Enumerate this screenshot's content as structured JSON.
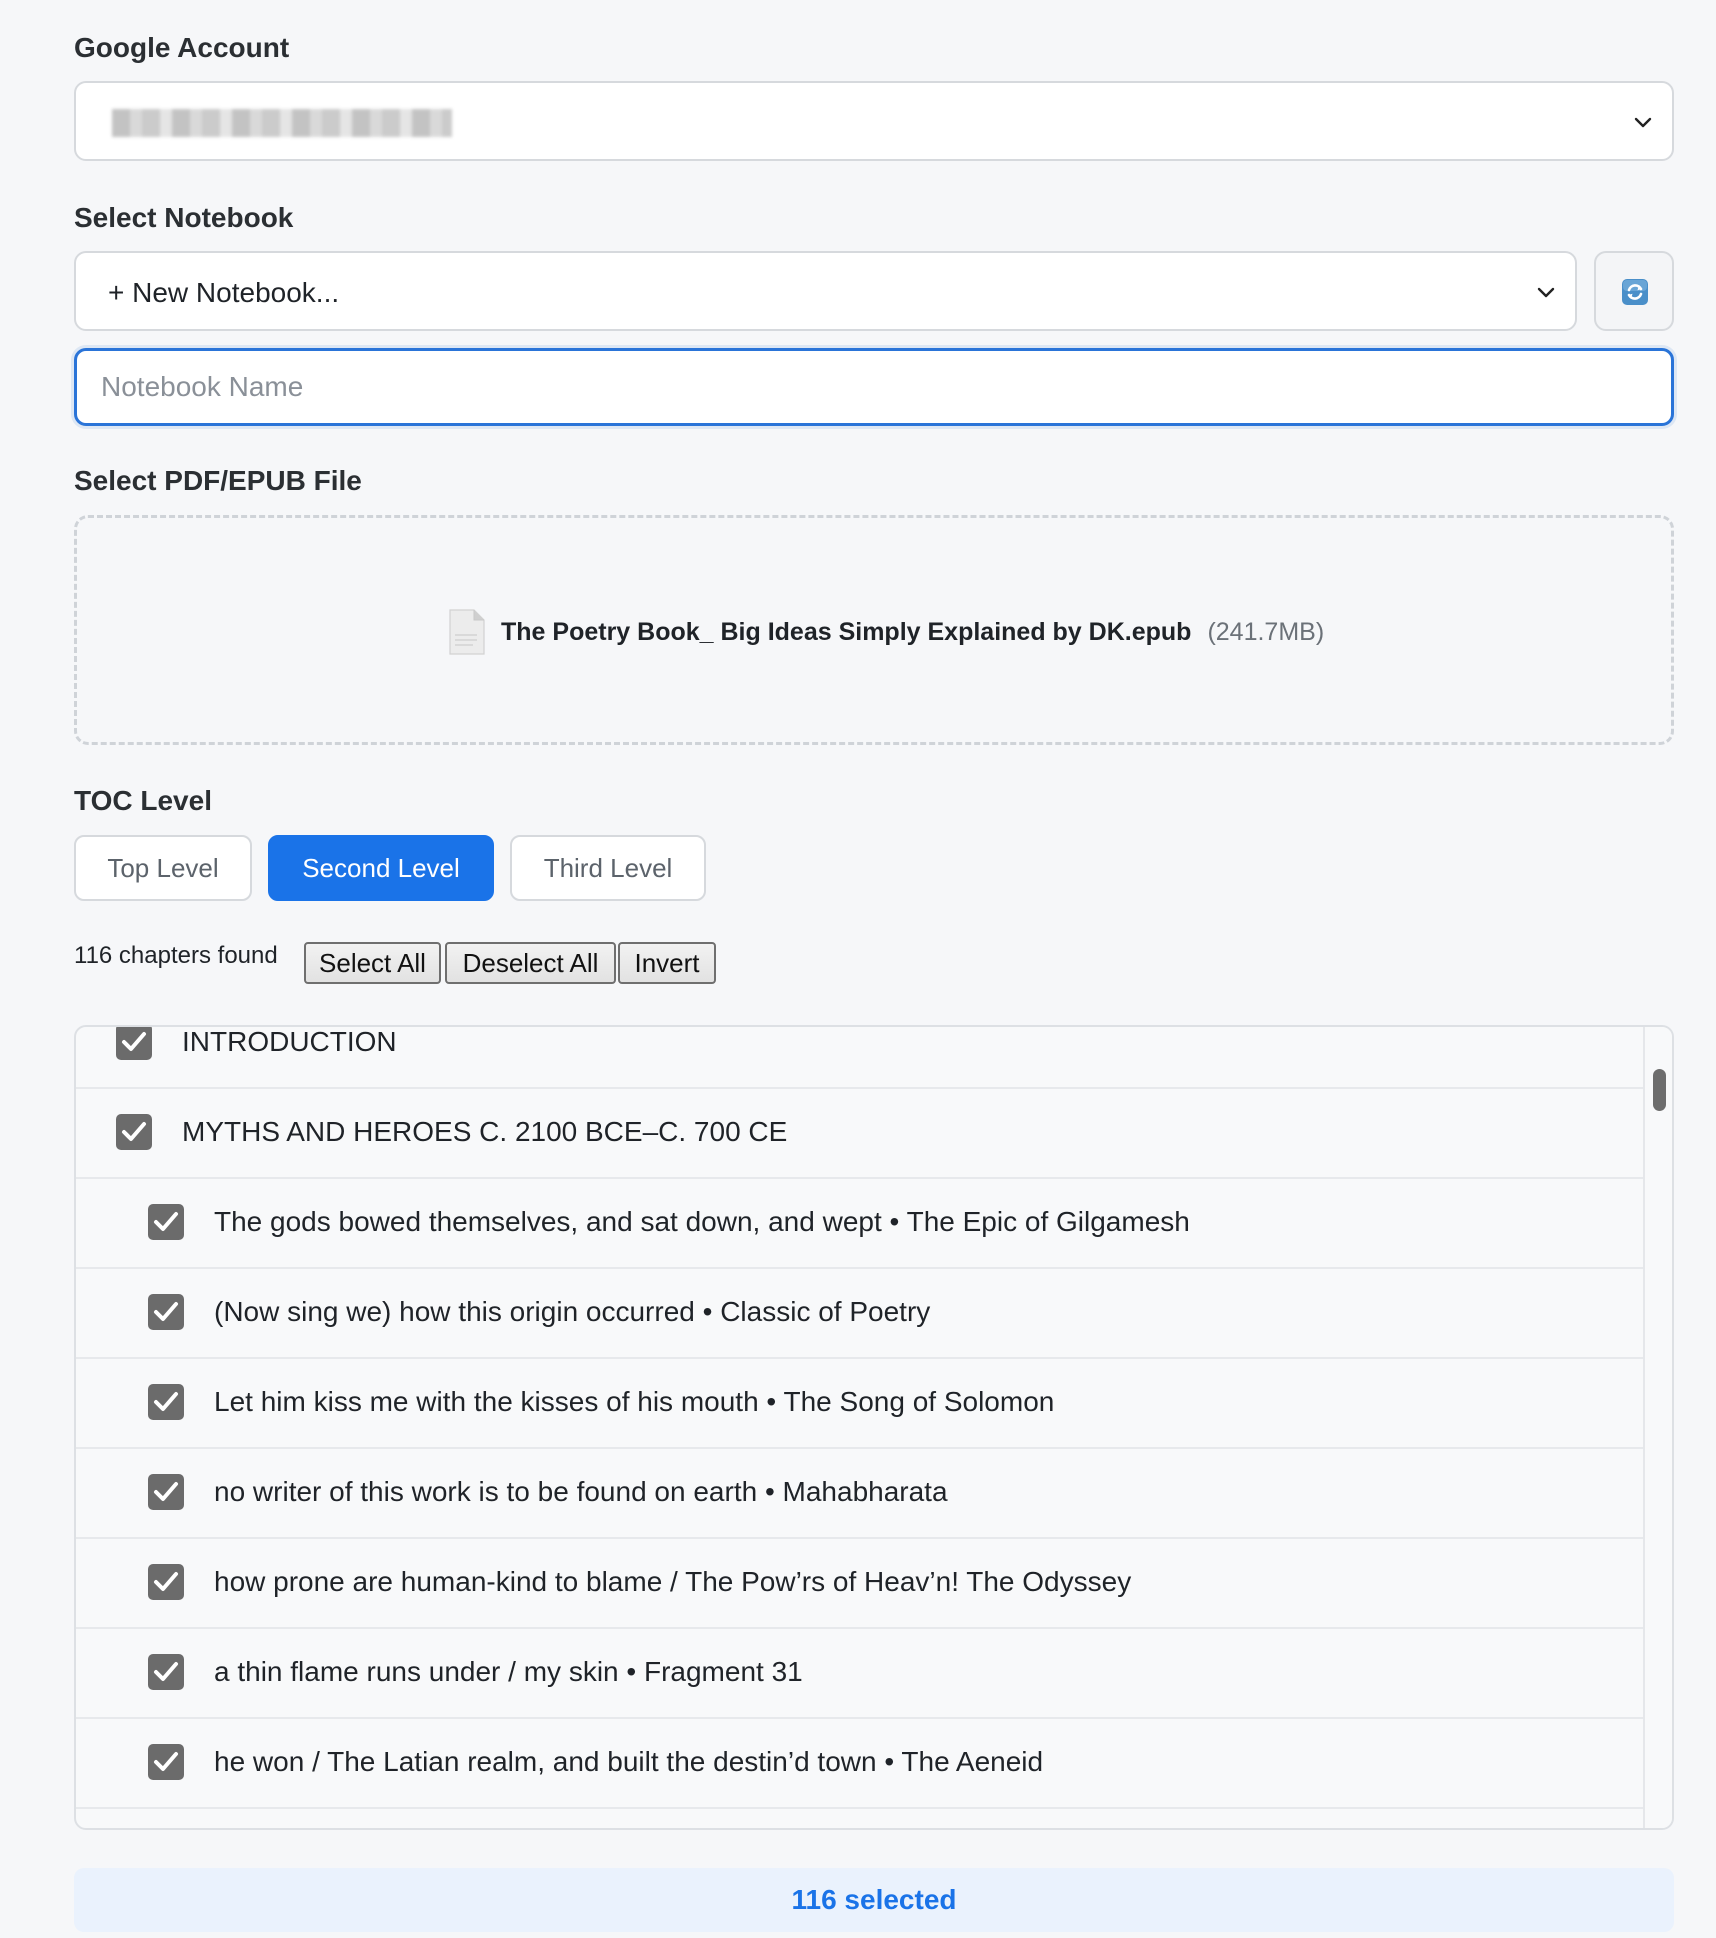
{
  "account": {
    "label": "Google Account",
    "value": ""
  },
  "notebook": {
    "label": "Select Notebook",
    "selected": "+ New Notebook...",
    "name_placeholder": "Notebook Name"
  },
  "file": {
    "label": "Select PDF/EPUB File",
    "name": "The Poetry Book_ Big Ideas Simply Explained by DK.epub",
    "size": "(241.7MB)"
  },
  "toc": {
    "label": "TOC Level",
    "options": [
      "Top Level",
      "Second Level",
      "Third Level"
    ],
    "active": "Second Level"
  },
  "chapters": {
    "count_text": "116 chapters found",
    "select_all": "Select All",
    "deselect_all": "Deselect All",
    "invert": "Invert",
    "items": [
      {
        "text": "INTRODUCTION",
        "level": 1,
        "checked": true
      },
      {
        "text": "MYTHS AND HEROES C. 2100 BCE–C. 700 CE",
        "level": 1,
        "checked": true
      },
      {
        "text": "The gods bowed themselves, and sat down, and wept • The Epic of Gilgamesh",
        "level": 2,
        "checked": true
      },
      {
        "text": "(Now sing we) how this origin occurred • Classic of Poetry",
        "level": 2,
        "checked": true
      },
      {
        "text": "Let him kiss me with the kisses of his mouth • The Song of Solomon",
        "level": 2,
        "checked": true
      },
      {
        "text": "no writer of this work is to be found on earth • Mahabharata",
        "level": 2,
        "checked": true
      },
      {
        "text": "how prone are human-kind to blame / The Pow’rs of Heav’n! The Odyssey",
        "level": 2,
        "checked": true
      },
      {
        "text": "a thin flame runs under / my skin • Fragment 31",
        "level": 2,
        "checked": true
      },
      {
        "text": "he won / The Latian realm, and built the destin’d town • The Aeneid",
        "level": 2,
        "checked": true
      }
    ]
  },
  "selected_text": "116 selected",
  "colors": {
    "accent": "#1a73e8",
    "focus": "#2a74d8"
  },
  "icons": {
    "dropdown": "chevron-down-icon",
    "refresh": "refresh-icon",
    "file": "document-icon",
    "check": "checkmark-icon"
  }
}
